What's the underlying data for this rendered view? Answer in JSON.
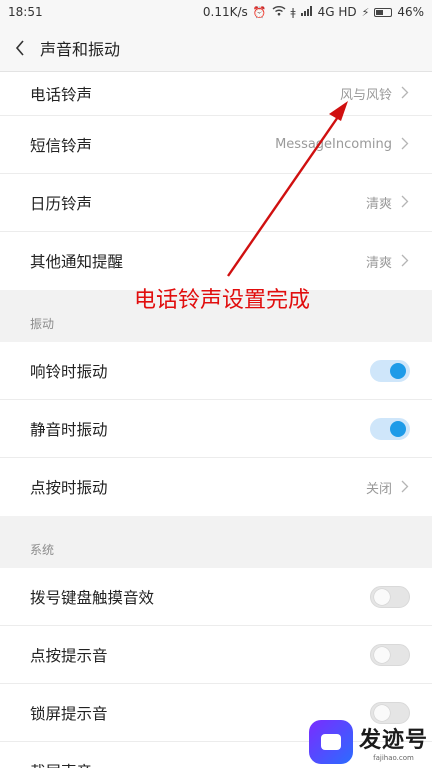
{
  "status_bar": {
    "time": "18:51",
    "speed": "0.11K/s",
    "network": "4G HD",
    "battery": "46%"
  },
  "header": {
    "title": "声音和振动"
  },
  "ringtones": [
    {
      "label": "电话铃声",
      "value": "风与风铃"
    },
    {
      "label": "短信铃声",
      "value": "MessageIncoming"
    },
    {
      "label": "日历铃声",
      "value": "清爽"
    },
    {
      "label": "其他通知提醒",
      "value": "清爽"
    }
  ],
  "vibration": {
    "title": "振动",
    "items": [
      {
        "label": "响铃时振动",
        "on": true
      },
      {
        "label": "静音时振动",
        "on": true
      },
      {
        "label": "点按时振动",
        "value": "关闭"
      }
    ]
  },
  "system": {
    "title": "系统",
    "items": [
      {
        "label": "拨号键盘触摸音效",
        "on": false
      },
      {
        "label": "点按提示音",
        "on": false
      },
      {
        "label": "锁屏提示音",
        "on": false
      },
      {
        "label": "截屏声音"
      }
    ]
  },
  "annotation": {
    "text": "电话铃声设置完成",
    "color": "#e10d0d"
  },
  "watermark": {
    "name": "发迹号",
    "url": "fajihao.com"
  },
  "colors": {
    "accent": "#1e9be8"
  }
}
